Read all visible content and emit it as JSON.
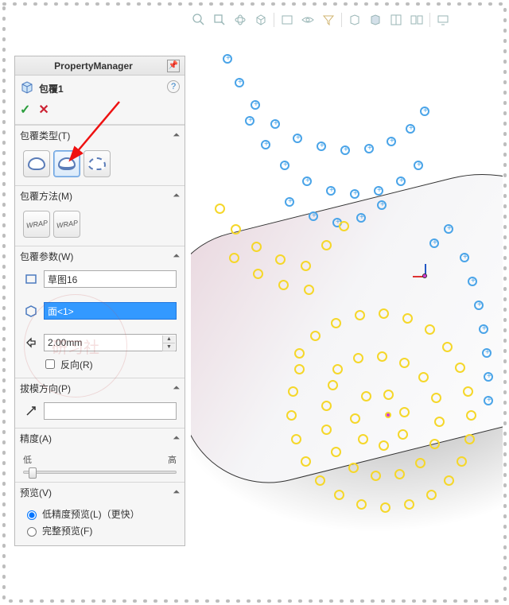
{
  "pm": {
    "title": "PropertyManager",
    "feature_name": "包覆1",
    "sections": {
      "wrap_type": {
        "label": "包覆类型(T)"
      },
      "wrap_method": {
        "label": "包覆方法(M)"
      },
      "wrap_params": {
        "label": "包覆参数(W)"
      },
      "draft_dir": {
        "label": "拔模方向(P)"
      },
      "accuracy": {
        "label": "精度(A)",
        "low": "低",
        "high": "高"
      },
      "preview": {
        "label": "预览(V)",
        "low_label": "低精度预览(L)（更快）",
        "full_label": "完整预览(F)"
      }
    },
    "params": {
      "sketch": "草图16",
      "face": "面<1>",
      "thickness": "2.00mm",
      "reverse": "反向(R)"
    }
  }
}
